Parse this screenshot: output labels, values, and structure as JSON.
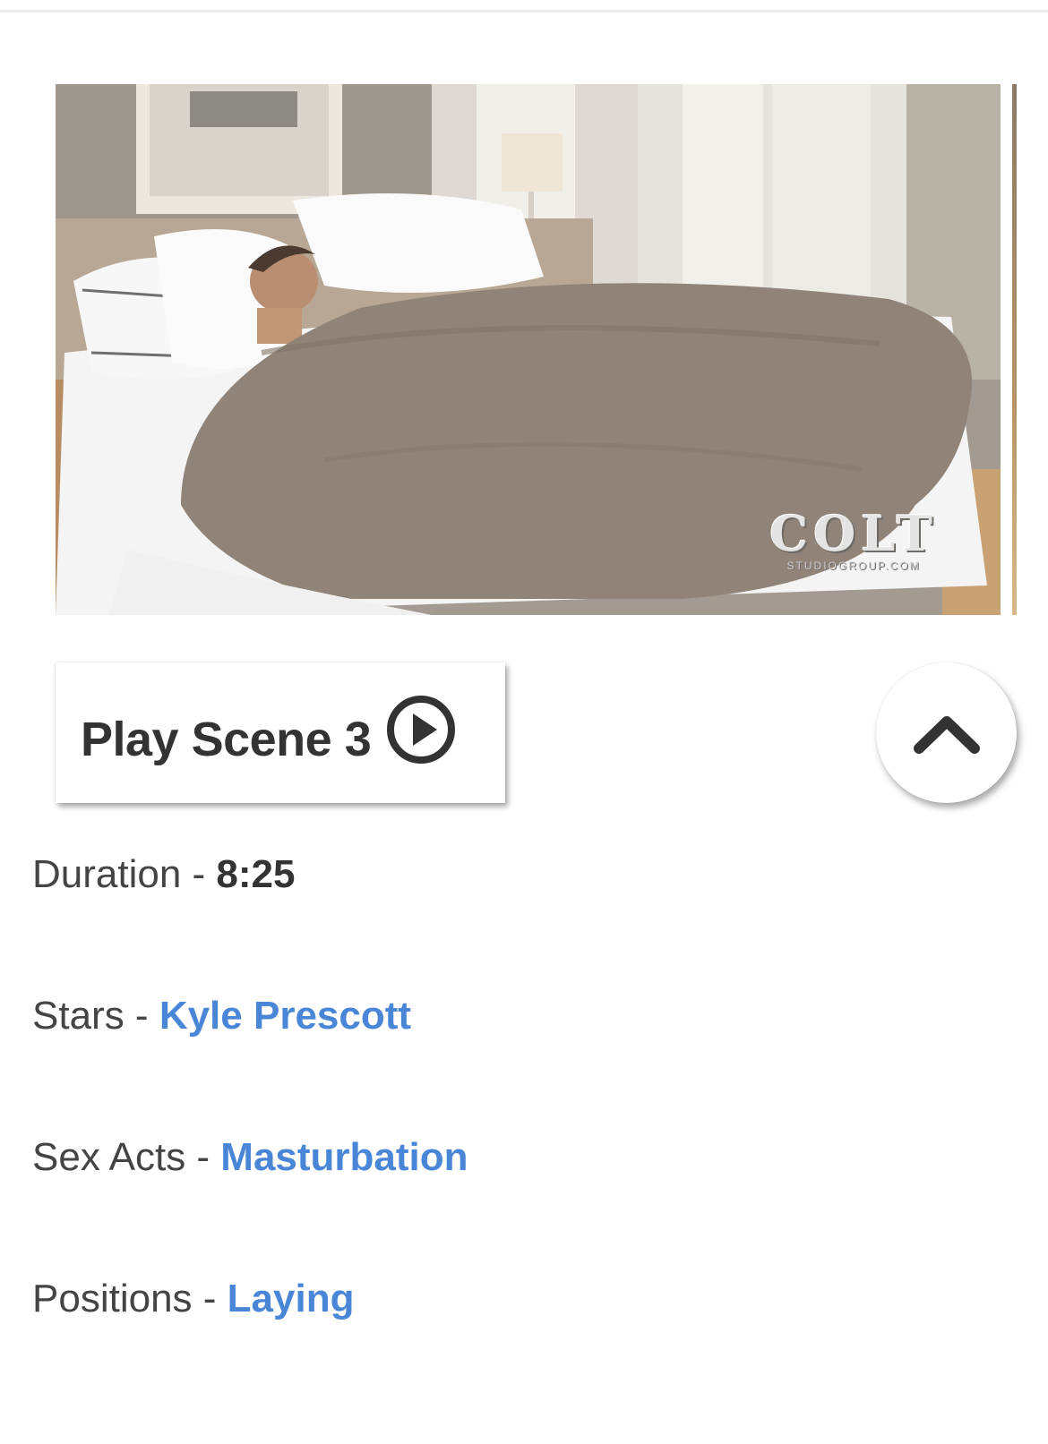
{
  "scene": {
    "image_alt": "Scene 3 preview",
    "watermark_main": "COLT",
    "watermark_sub": "STUDIOGROUP.COM",
    "play_label": "Play Scene 3",
    "play_icon": "play-circle-icon",
    "scroll_top_icon": "chevron-up-icon"
  },
  "details": {
    "duration_label": "Duration",
    "duration_value": "8:25",
    "stars_label": "Stars",
    "stars_value": "Kyle Prescott",
    "acts_label": "Sex Acts",
    "acts_value": "Masturbation",
    "positions_label": "Positions",
    "positions_value": "Laying",
    "separator": " - "
  },
  "colors": {
    "link": "#4a86d8",
    "text": "#444444",
    "button_text": "#333333"
  }
}
